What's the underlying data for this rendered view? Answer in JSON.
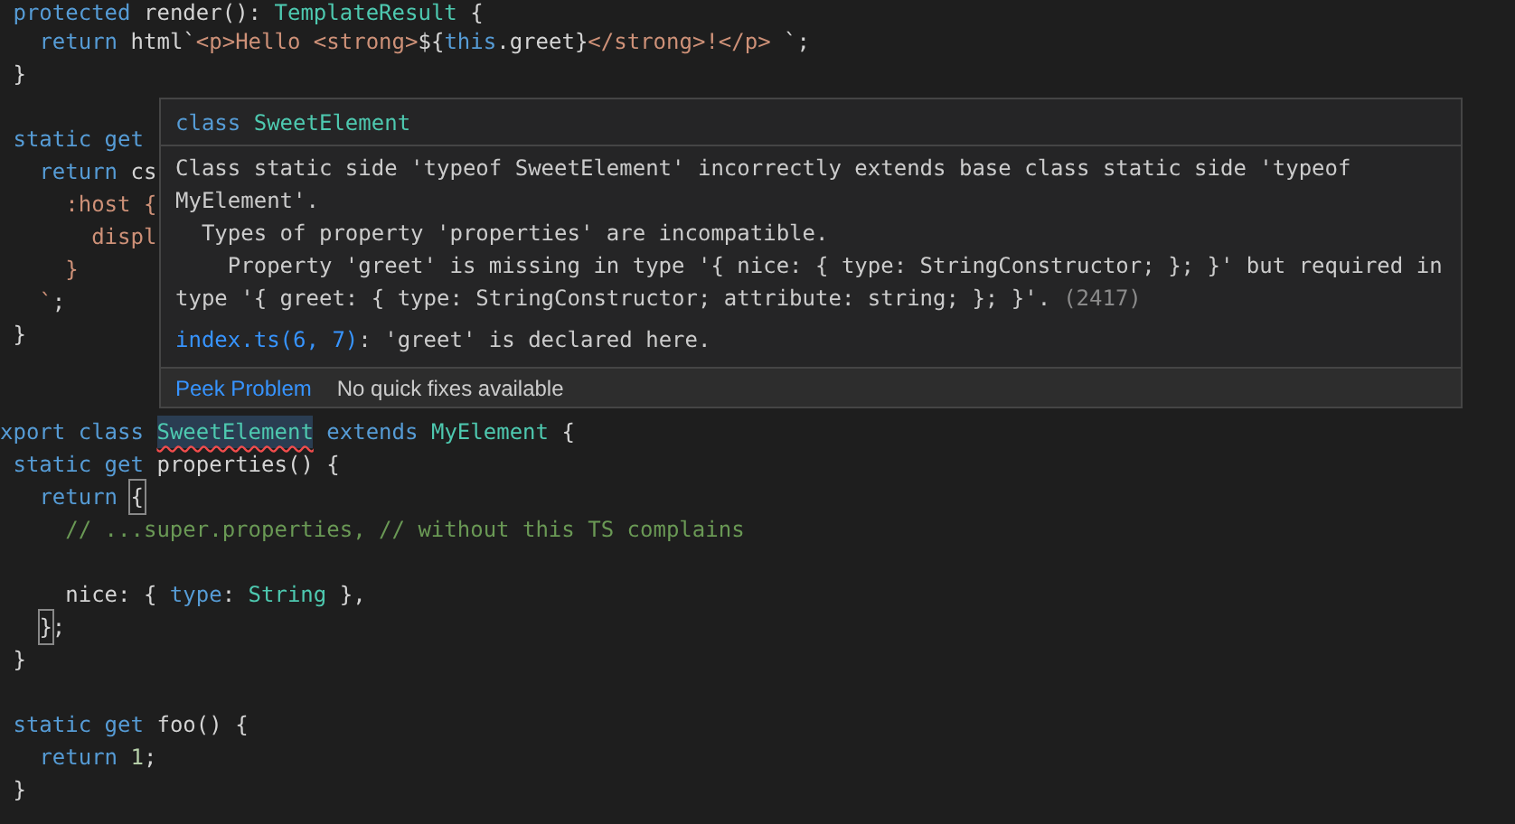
{
  "editor": {
    "lines": [
      {
        "kind": "code",
        "tokens": [
          {
            "kind": "keyword",
            "text": " protected"
          },
          {
            "kind": "plain",
            "text": " render(): "
          },
          {
            "kind": "type",
            "text": "TemplateResult"
          },
          {
            "kind": "plain",
            "text": " {"
          }
        ]
      },
      {
        "kind": "code",
        "tokens": [
          {
            "kind": "keyword",
            "text": "   return"
          },
          {
            "kind": "plain",
            "text": " html`"
          },
          {
            "kind": "string",
            "text": "<p>Hello <strong>"
          },
          {
            "kind": "plain",
            "text": "${"
          },
          {
            "kind": "keyword",
            "text": "this"
          },
          {
            "kind": "plain",
            "text": ".greet}"
          },
          {
            "kind": "string",
            "text": "</strong>!</p> "
          },
          {
            "kind": "plain",
            "text": "`;"
          }
        ]
      },
      {
        "kind": "code",
        "tokens": [
          {
            "kind": "plain",
            "text": " }"
          }
        ]
      },
      {
        "kind": "blank"
      },
      {
        "kind": "code",
        "tokens": [
          {
            "kind": "keyword",
            "text": " static get"
          }
        ]
      },
      {
        "kind": "code",
        "tokens": [
          {
            "kind": "keyword",
            "text": "   return"
          },
          {
            "kind": "plain",
            "text": " cs"
          }
        ]
      },
      {
        "kind": "code",
        "tokens": [
          {
            "kind": "string",
            "text": "     :host {"
          }
        ]
      },
      {
        "kind": "code",
        "tokens": [
          {
            "kind": "string",
            "text": "       displ"
          }
        ]
      },
      {
        "kind": "code",
        "tokens": [
          {
            "kind": "string",
            "text": "     }"
          }
        ]
      },
      {
        "kind": "code",
        "tokens": [
          {
            "kind": "string",
            "text": "   `"
          },
          {
            "kind": "plain",
            "text": ";"
          }
        ]
      },
      {
        "kind": "code",
        "tokens": [
          {
            "kind": "plain",
            "text": " }"
          }
        ]
      },
      {
        "kind": "blank"
      },
      {
        "kind": "blank"
      },
      {
        "kind": "code",
        "tokens": [
          {
            "kind": "keyword",
            "text": "xport class"
          },
          {
            "kind": "type",
            "text": " SweetElement",
            "error": true
          },
          {
            "kind": "keyword",
            "text": " extends"
          },
          {
            "kind": "type",
            "text": " MyElement"
          },
          {
            "kind": "plain",
            "text": " {"
          }
        ]
      },
      {
        "kind": "code",
        "tokens": [
          {
            "kind": "keyword",
            "text": " static get"
          },
          {
            "kind": "plain",
            "text": " properties() {"
          }
        ]
      },
      {
        "kind": "code",
        "tokens": [
          {
            "kind": "keyword",
            "text": "   return"
          },
          {
            "kind": "plain",
            "text": " {",
            "bracket_match": true
          }
        ]
      },
      {
        "kind": "code",
        "tokens": [
          {
            "kind": "comment",
            "text": "     // ...super.properties, // without this TS complains"
          }
        ]
      },
      {
        "kind": "blank"
      },
      {
        "kind": "code",
        "tokens": [
          {
            "kind": "plain",
            "text": "     nice: { "
          },
          {
            "kind": "keyword",
            "text": "type"
          },
          {
            "kind": "plain",
            "text": ": "
          },
          {
            "kind": "type",
            "text": "String"
          },
          {
            "kind": "plain",
            "text": " },"
          }
        ]
      },
      {
        "kind": "code",
        "tokens": [
          {
            "kind": "plain",
            "text": "   }",
            "bracket_match": true
          },
          {
            "kind": "plain",
            "text": ";"
          }
        ]
      },
      {
        "kind": "code",
        "tokens": [
          {
            "kind": "plain",
            "text": " }"
          }
        ]
      },
      {
        "kind": "blank"
      },
      {
        "kind": "code",
        "tokens": [
          {
            "kind": "keyword",
            "text": " static get"
          },
          {
            "kind": "plain",
            "text": " foo() {"
          }
        ]
      },
      {
        "kind": "code",
        "tokens": [
          {
            "kind": "keyword",
            "text": "   return"
          },
          {
            "kind": "number",
            "text": " 1"
          },
          {
            "kind": "plain",
            "text": ";"
          }
        ]
      },
      {
        "kind": "code",
        "tokens": [
          {
            "kind": "plain",
            "text": " }"
          }
        ]
      }
    ]
  },
  "hover": {
    "signature_keyword": "class",
    "signature_name": "SweetElement",
    "message_lines": [
      "Class static side 'typeof SweetElement' incorrectly extends base class static side 'typeof",
      "MyElement'.",
      "  Types of property 'properties' are incompatible.",
      "    Property 'greet' is missing in type '{ nice: { type: StringConstructor; }; }' but required in",
      "type '{ greet: { type: StringConstructor; attribute: string; }; }'."
    ],
    "error_code": "(2417)",
    "related_link": "index.ts(6, 7)",
    "related_text": ": 'greet' is declared here.",
    "actions": [
      "Peek Problem"
    ],
    "status": "No quick fixes available"
  }
}
